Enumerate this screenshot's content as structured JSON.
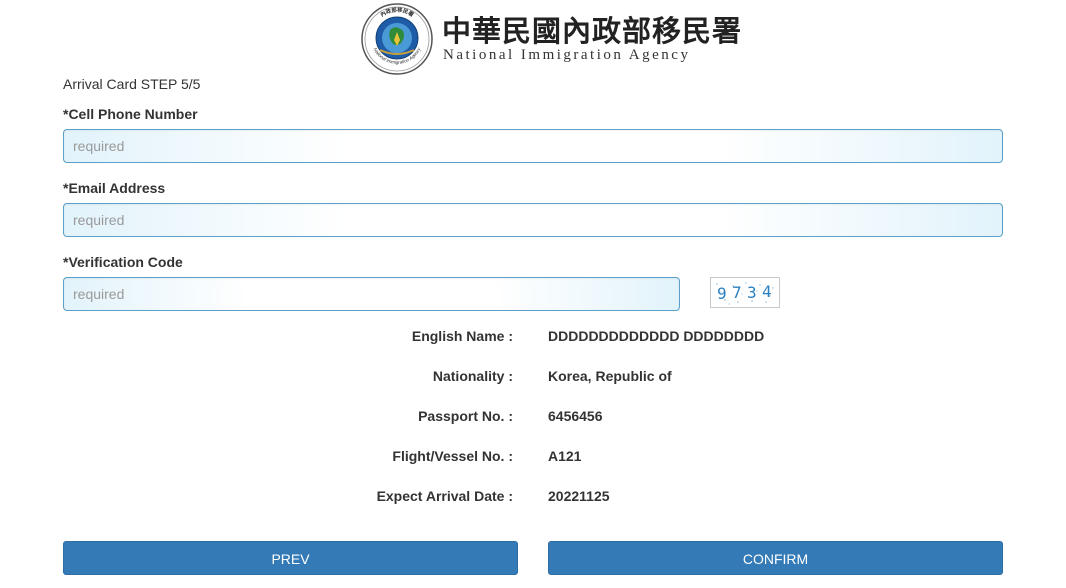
{
  "header": {
    "agency_name_zh": "中華民國內政部移民署",
    "agency_name_en": "National Immigration Agency",
    "logo_top_text": "內政部移民署",
    "logo_ring_text": "National Immigration Agency"
  },
  "form": {
    "step_title": "Arrival Card STEP 5/5",
    "phone": {
      "label": "*Cell Phone Number",
      "placeholder": "required",
      "value": ""
    },
    "email": {
      "label": "*Email Address",
      "placeholder": "required",
      "value": ""
    },
    "verification": {
      "label": "*Verification Code",
      "placeholder": "required",
      "value": ""
    },
    "captcha": {
      "text": "9734",
      "digits": [
        "9",
        "7",
        "3",
        "4"
      ],
      "color": "#2a7fc0"
    }
  },
  "summary": [
    {
      "label": "English Name :",
      "value": "DDDDDDDDDDDDD DDDDDDDD"
    },
    {
      "label": "Nationality :",
      "value": "Korea, Republic of"
    },
    {
      "label": "Passport No. :",
      "value": "6456456"
    },
    {
      "label": "Flight/Vessel No. :",
      "value": "A121"
    },
    {
      "label": "Expect Arrival Date :",
      "value": "20221125"
    }
  ],
  "buttons": {
    "prev": "PREV",
    "confirm": "CONFIRM"
  },
  "colors": {
    "button": "#337ab7",
    "input_border": "#5aa0c8",
    "input_tint": "#e2f3fb"
  }
}
